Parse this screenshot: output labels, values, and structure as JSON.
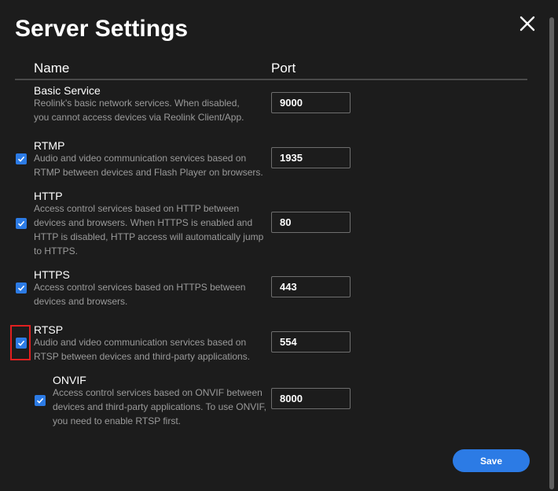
{
  "dialog": {
    "title": "Server Settings",
    "close_icon": "close-icon"
  },
  "table": {
    "columns": {
      "name": "Name",
      "port": "Port"
    }
  },
  "services": [
    {
      "name": "Basic Service",
      "description": "Reolink's basic network services. When disabled, you cannot access devices via Reolink Client/App.",
      "port": "9000",
      "has_checkbox": false
    },
    {
      "name": "RTMP",
      "description": "Audio and video communication services based on RTMP between devices and Flash Player on browsers.",
      "port": "1935",
      "has_checkbox": true,
      "checked": true
    },
    {
      "name": "HTTP",
      "description": "Access control services based on HTTP between devices and browsers. When HTTPS is enabled and HTTP is disabled, HTTP access will automatically jump to HTTPS.",
      "port": "80",
      "has_checkbox": true,
      "checked": true
    },
    {
      "name": "HTTPS",
      "description": "Access control services based on HTTPS between devices and browsers.",
      "port": "443",
      "has_checkbox": true,
      "checked": true
    },
    {
      "name": "RTSP",
      "description": "Audio and video communication services based on RTSP between devices and third-party applications.",
      "port": "554",
      "has_checkbox": true,
      "checked": true
    },
    {
      "name": "ONVIF",
      "description": "Access control services based on ONVIF between devices and third-party applications. To use ONVIF, you need to enable RTSP first.",
      "port": "8000",
      "has_checkbox": true,
      "checked": true
    }
  ],
  "footer": {
    "save_label": "Save"
  },
  "colors": {
    "background": "#1c1c1c",
    "accent": "#2c7be5",
    "muted_text": "#9a9a9a",
    "highlight": "#e02020"
  }
}
